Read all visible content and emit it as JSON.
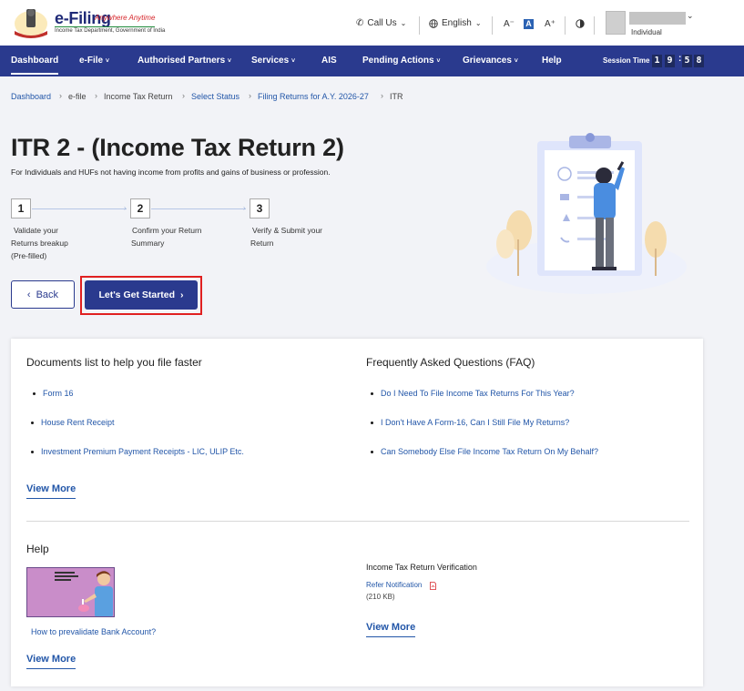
{
  "header": {
    "brand": "e-Filing",
    "tagline": "Anywhere Anytime",
    "department": "Income Tax Department, Government of India",
    "call_us": "Call Us",
    "language": "English",
    "font_decrease": "A⁻",
    "font_normal": "A",
    "font_increase": "A⁺",
    "user_role": "Individual"
  },
  "nav": {
    "items": [
      "Dashboard",
      "e-File",
      "Authorised Partners",
      "Services",
      "AIS",
      "Pending Actions",
      "Grievances",
      "Help"
    ],
    "session_label": "Session Time",
    "session_digits": [
      "1",
      "9",
      "5",
      "8"
    ]
  },
  "breadcrumb": [
    "Dashboard",
    "e-file",
    "Income Tax Return",
    "Select Status",
    "Filing Returns for A.Y. 2026-27",
    "ITR"
  ],
  "hero": {
    "title": "ITR 2 - (Income Tax Return 2)",
    "subtitle": "For Individuals and HUFs not having income from profits and gains of business or profession.",
    "steps": [
      {
        "num": "1",
        "line1": "Validate your",
        "line2": "Returns breakup",
        "line3": "(Pre-filled)"
      },
      {
        "num": "2",
        "line1": "Confirm your Return",
        "line2": "Summary",
        "line3": ""
      },
      {
        "num": "3",
        "line1": "Verify & Submit your",
        "line2": "Return",
        "line3": ""
      }
    ],
    "back_label": "Back",
    "start_label": "Let's Get Started"
  },
  "documents": {
    "title": "Documents list to help you file faster",
    "items": [
      "Form 16",
      "House Rent Receipt",
      "Investment Premium Payment Receipts - LIC, ULIP Etc."
    ],
    "view_more": "View More"
  },
  "faq": {
    "title": "Frequently Asked Questions (FAQ)",
    "items": [
      "Do I Need To File Income Tax Returns For This Year?",
      "I Don't Have A Form-16, Can I Still File My Returns?",
      "Can Somebody Else File Income Tax Return On My Behalf?"
    ]
  },
  "help": {
    "title": "Help",
    "video_link": "How to prevalidate Bank Account?",
    "view_more": "View More",
    "verification_title": "Income Tax Return Verification",
    "refer_link": "Refer Notification",
    "file_size": "(210 KB)",
    "view_more_2": "View More"
  },
  "colors": {
    "primary": "#2a3a8e",
    "link": "#2256a8",
    "highlight": "#e02020"
  }
}
